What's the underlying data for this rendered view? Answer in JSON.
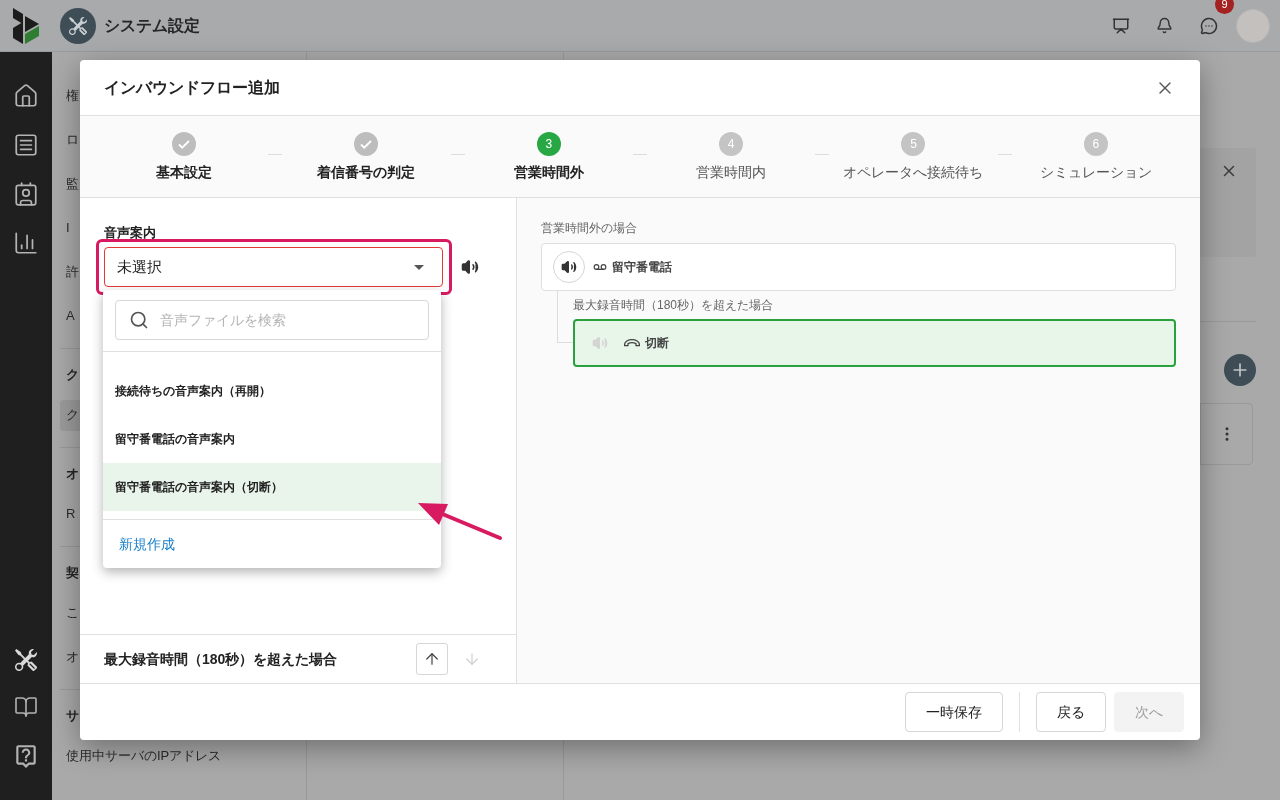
{
  "app_header": {
    "title": "システム設定",
    "chat_badge": "9"
  },
  "sidebar": {
    "groups": [
      {
        "items": [
          {
            "label": "権",
            "selected": false
          },
          {
            "label": "ロ",
            "selected": false
          },
          {
            "label": "監",
            "selected": false
          },
          {
            "label": "I",
            "selected": false
          },
          {
            "label": "許",
            "selected": false
          },
          {
            "label": "A",
            "selected": false
          }
        ]
      },
      {
        "heading": "ク",
        "items": [
          {
            "label": "ク",
            "selected": true
          }
        ]
      },
      {
        "heading": "オ",
        "items": [
          {
            "label": "R",
            "selected": false
          }
        ]
      },
      {
        "heading": "契",
        "items": [
          {
            "label": "こ",
            "selected": false
          },
          {
            "label": "オ",
            "selected": false
          }
        ]
      },
      {
        "heading": "サ",
        "items": [
          {
            "label": "使用中サーバのIPアドレス",
            "selected": false
          }
        ]
      }
    ]
  },
  "dialog": {
    "title": "インバウンドフロー追加",
    "steps": [
      {
        "label": "基本設定",
        "completed": true,
        "selected": false
      },
      {
        "label": "着信番号の判定",
        "completed": true,
        "selected": false
      },
      {
        "number": "3",
        "label": "営業時間外",
        "completed": false,
        "selected": true
      },
      {
        "number": "4",
        "label": "営業時間内",
        "completed": false,
        "selected": false
      },
      {
        "number": "5",
        "label": "オペレータへ接続待ち",
        "completed": false,
        "selected": false
      },
      {
        "number": "6",
        "label": "シミュレーション",
        "completed": false,
        "selected": false
      }
    ],
    "voice_guide": {
      "label": "音声案内",
      "value": "未選択",
      "invalid": true,
      "search_placeholder": "音声ファイルを検索",
      "options": [
        {
          "label": "接続待ちの音声案内（再開）",
          "selected": false
        },
        {
          "label": "留守番電話の音声案内",
          "selected": false
        },
        {
          "label": "留守番電話の音声案内（切断）",
          "selected": true
        }
      ],
      "create_link": "新規作成"
    },
    "condition_bar": {
      "label": "最大録音時間（180秒）を超えた場合",
      "move_buttons": [
        {
          "kind": "up",
          "disabled": false
        },
        {
          "kind": "down",
          "disabled": true
        }
      ]
    },
    "flow": {
      "heading": "営業時間外の場合",
      "node": {
        "kind": "voicemail",
        "label": "留守番電話",
        "audio": true
      },
      "branch": {
        "heading": "最大録音時間（180秒）を超えた場合",
        "node": {
          "kind": "hangup",
          "label": "切断",
          "audio": false,
          "selected": true
        }
      }
    },
    "footer_buttons": [
      {
        "label": "一時保存",
        "disabled": false
      },
      {
        "label": "戻る",
        "disabled": false
      },
      {
        "label": "次へ",
        "disabled": true
      }
    ]
  }
}
